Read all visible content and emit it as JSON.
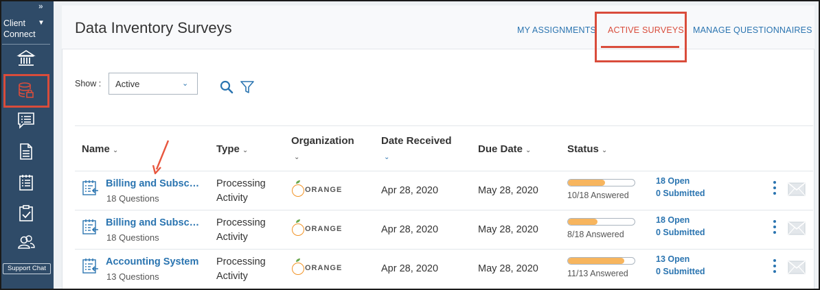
{
  "sidebar": {
    "client_line1": "Client",
    "client_line2": "Connect",
    "support_chat": "Support Chat"
  },
  "header": {
    "title": "Data Inventory Surveys",
    "tabs": [
      {
        "label": "MY ASSIGNMENTS"
      },
      {
        "label": "ACTIVE SURVEYS"
      },
      {
        "label": "MANAGE QUESTIONNAIRES"
      }
    ]
  },
  "filters": {
    "show_label": "Show :",
    "show_value": "Active"
  },
  "table": {
    "columns": [
      "Name",
      "Type",
      "Organization",
      "Date Received",
      "Due Date",
      "Status"
    ],
    "rows": [
      {
        "name": "Billing and Subscriptions",
        "questions": "18 Questions",
        "type_line1": "Processing",
        "type_line2": "Activity",
        "org": "ORANGE",
        "received": "Apr 28, 2020",
        "due": "May 28, 2020",
        "progress": 0.555,
        "answered": "10/18 Answered",
        "open": "18 Open",
        "submitted": "0 Submitted"
      },
      {
        "name": "Billing and Subscriptions",
        "questions": "18 Questions",
        "type_line1": "Processing",
        "type_line2": "Activity",
        "org": "ORANGE",
        "received": "Apr 28, 2020",
        "due": "May 28, 2020",
        "progress": 0.444,
        "answered": "8/18 Answered",
        "open": "18 Open",
        "submitted": "0 Submitted"
      },
      {
        "name": "Accounting System",
        "questions": "13 Questions",
        "type_line1": "Processing",
        "type_line2": "Activity",
        "org": "ORANGE",
        "received": "Apr 28, 2020",
        "due": "May 28, 2020",
        "progress": 0.846,
        "answered": "11/13 Answered",
        "open": "13 Open",
        "submitted": "0 Submitted"
      }
    ]
  },
  "colors": {
    "sidebar": "#2f4b68",
    "link": "#2a74b0",
    "highlight": "#d94c3b",
    "progress": "#f7b55e",
    "org": "#f29325"
  }
}
